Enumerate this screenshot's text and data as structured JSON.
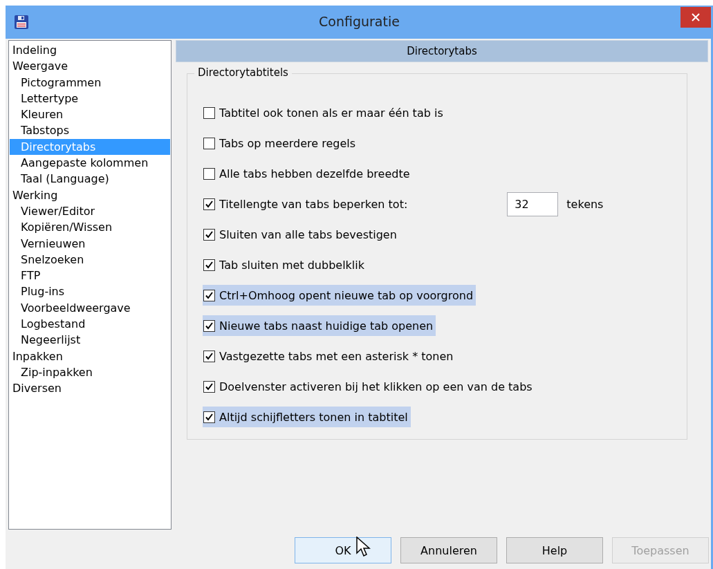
{
  "window": {
    "title": "Configuratie"
  },
  "sidebar": {
    "items": [
      {
        "label": "Indeling",
        "selected": false
      },
      {
        "label": "Weergave",
        "selected": false,
        "children": [
          {
            "label": "Pictogrammen",
            "selected": false
          },
          {
            "label": "Lettertype",
            "selected": false
          },
          {
            "label": "Kleuren",
            "selected": false
          },
          {
            "label": "Tabstops",
            "selected": false
          },
          {
            "label": "Directorytabs",
            "selected": true
          },
          {
            "label": "Aangepaste kolommen",
            "selected": false
          },
          {
            "label": "Taal (Language)",
            "selected": false
          }
        ]
      },
      {
        "label": "Werking",
        "selected": false,
        "children": [
          {
            "label": "Viewer/Editor",
            "selected": false
          },
          {
            "label": "Kopiëren/Wissen",
            "selected": false
          },
          {
            "label": "Vernieuwen",
            "selected": false
          },
          {
            "label": "Snelzoeken",
            "selected": false
          },
          {
            "label": "FTP",
            "selected": false
          },
          {
            "label": "Plug-ins",
            "selected": false
          },
          {
            "label": "Voorbeeldweergave",
            "selected": false
          },
          {
            "label": "Logbestand",
            "selected": false
          },
          {
            "label": "Negeerlijst",
            "selected": false
          }
        ]
      },
      {
        "label": "Inpakken",
        "selected": false,
        "children": [
          {
            "label": "Zip-inpakken",
            "selected": false
          }
        ]
      },
      {
        "label": "Diversen",
        "selected": false
      }
    ]
  },
  "panel": {
    "header": "Directorytabs",
    "group": {
      "title": "Directorytabtitels",
      "options": [
        {
          "label": "Tabtitel ook tonen als er maar één tab is",
          "checked": false,
          "highlighted": false
        },
        {
          "label": "Tabs op meerdere regels",
          "checked": false,
          "highlighted": false
        },
        {
          "label": "Alle tabs hebben dezelfde breedte",
          "checked": false,
          "highlighted": false
        },
        {
          "label": "Titellengte van tabs beperken tot:",
          "checked": true,
          "highlighted": false,
          "field": {
            "value": "32",
            "unit": "tekens"
          }
        },
        {
          "label": "Sluiten van alle tabs bevestigen",
          "checked": true,
          "highlighted": false
        },
        {
          "label": "Tab sluiten met dubbelklik",
          "checked": true,
          "highlighted": false
        },
        {
          "label": "Ctrl+Omhoog opent nieuwe tab op voorgrond",
          "checked": true,
          "highlighted": true
        },
        {
          "label": "Nieuwe tabs naast huidige tab openen",
          "checked": true,
          "highlighted": true
        },
        {
          "label": "Vastgezette tabs met een asterisk * tonen",
          "checked": true,
          "highlighted": false
        },
        {
          "label": "Doelvenster activeren bij het klikken op een van de tabs",
          "checked": true,
          "highlighted": false
        },
        {
          "label": "Altijd schijfletters tonen in tabtitel",
          "checked": true,
          "highlighted": true
        }
      ]
    }
  },
  "buttons": [
    {
      "label": "OK",
      "default": true,
      "disabled": false
    },
    {
      "label": "Annuleren",
      "default": false,
      "disabled": false
    },
    {
      "label": "Help",
      "default": false,
      "disabled": false
    },
    {
      "label": "Toepassen",
      "default": false,
      "disabled": true
    }
  ]
}
